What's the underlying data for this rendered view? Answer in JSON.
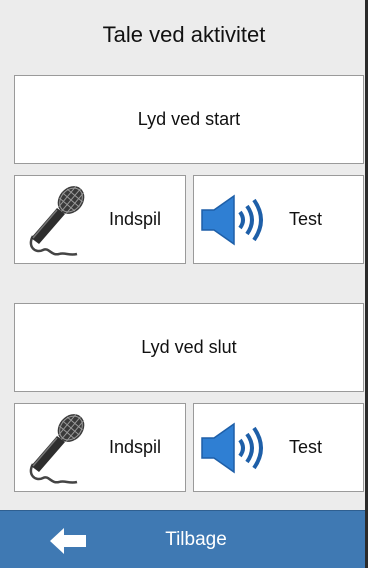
{
  "header": {
    "title": "Tale ved aktivitet"
  },
  "start_section": {
    "label": "Lyd ved start",
    "record_label": "Indspil",
    "test_label": "Test"
  },
  "end_section": {
    "label": "Lyd ved slut",
    "record_label": "Indspil",
    "test_label": "Test"
  },
  "footer": {
    "back_label": "Tilbage",
    "back_icon": "arrow-left-icon"
  },
  "icons": {
    "record": "microphone-icon",
    "test": "speaker-icon"
  },
  "colors": {
    "background": "#ececec",
    "footer": "#3f79b3",
    "speaker_blue": "#2f7fd3"
  }
}
